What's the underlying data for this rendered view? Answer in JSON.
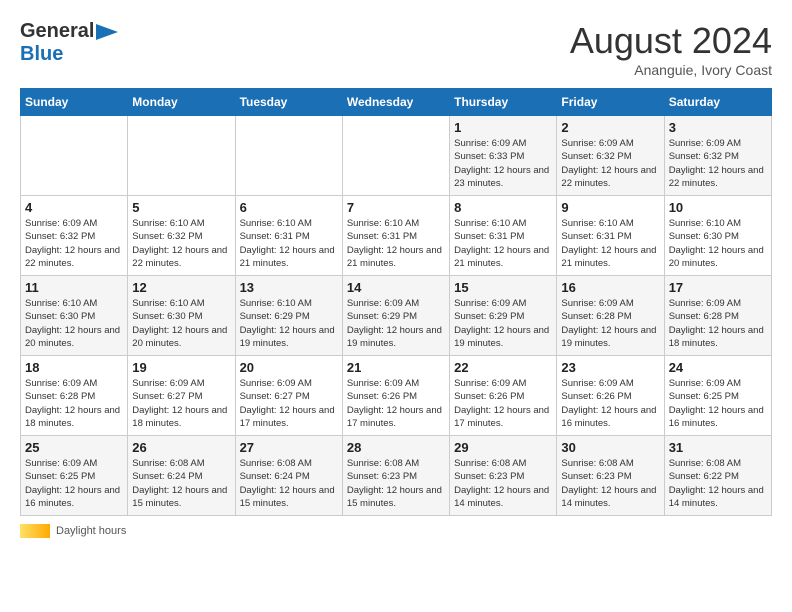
{
  "header": {
    "logo_general": "General",
    "logo_blue": "Blue",
    "month": "August 2024",
    "location": "Ananguie, Ivory Coast"
  },
  "days_of_week": [
    "Sunday",
    "Monday",
    "Tuesday",
    "Wednesday",
    "Thursday",
    "Friday",
    "Saturday"
  ],
  "weeks": [
    [
      {
        "day": "",
        "info": ""
      },
      {
        "day": "",
        "info": ""
      },
      {
        "day": "",
        "info": ""
      },
      {
        "day": "",
        "info": ""
      },
      {
        "day": "1",
        "info": "Sunrise: 6:09 AM\nSunset: 6:33 PM\nDaylight: 12 hours and 23 minutes."
      },
      {
        "day": "2",
        "info": "Sunrise: 6:09 AM\nSunset: 6:32 PM\nDaylight: 12 hours and 22 minutes."
      },
      {
        "day": "3",
        "info": "Sunrise: 6:09 AM\nSunset: 6:32 PM\nDaylight: 12 hours and 22 minutes."
      }
    ],
    [
      {
        "day": "4",
        "info": "Sunrise: 6:09 AM\nSunset: 6:32 PM\nDaylight: 12 hours and 22 minutes."
      },
      {
        "day": "5",
        "info": "Sunrise: 6:10 AM\nSunset: 6:32 PM\nDaylight: 12 hours and 22 minutes."
      },
      {
        "day": "6",
        "info": "Sunrise: 6:10 AM\nSunset: 6:31 PM\nDaylight: 12 hours and 21 minutes."
      },
      {
        "day": "7",
        "info": "Sunrise: 6:10 AM\nSunset: 6:31 PM\nDaylight: 12 hours and 21 minutes."
      },
      {
        "day": "8",
        "info": "Sunrise: 6:10 AM\nSunset: 6:31 PM\nDaylight: 12 hours and 21 minutes."
      },
      {
        "day": "9",
        "info": "Sunrise: 6:10 AM\nSunset: 6:31 PM\nDaylight: 12 hours and 21 minutes."
      },
      {
        "day": "10",
        "info": "Sunrise: 6:10 AM\nSunset: 6:30 PM\nDaylight: 12 hours and 20 minutes."
      }
    ],
    [
      {
        "day": "11",
        "info": "Sunrise: 6:10 AM\nSunset: 6:30 PM\nDaylight: 12 hours and 20 minutes."
      },
      {
        "day": "12",
        "info": "Sunrise: 6:10 AM\nSunset: 6:30 PM\nDaylight: 12 hours and 20 minutes."
      },
      {
        "day": "13",
        "info": "Sunrise: 6:10 AM\nSunset: 6:29 PM\nDaylight: 12 hours and 19 minutes."
      },
      {
        "day": "14",
        "info": "Sunrise: 6:09 AM\nSunset: 6:29 PM\nDaylight: 12 hours and 19 minutes."
      },
      {
        "day": "15",
        "info": "Sunrise: 6:09 AM\nSunset: 6:29 PM\nDaylight: 12 hours and 19 minutes."
      },
      {
        "day": "16",
        "info": "Sunrise: 6:09 AM\nSunset: 6:28 PM\nDaylight: 12 hours and 19 minutes."
      },
      {
        "day": "17",
        "info": "Sunrise: 6:09 AM\nSunset: 6:28 PM\nDaylight: 12 hours and 18 minutes."
      }
    ],
    [
      {
        "day": "18",
        "info": "Sunrise: 6:09 AM\nSunset: 6:28 PM\nDaylight: 12 hours and 18 minutes."
      },
      {
        "day": "19",
        "info": "Sunrise: 6:09 AM\nSunset: 6:27 PM\nDaylight: 12 hours and 18 minutes."
      },
      {
        "day": "20",
        "info": "Sunrise: 6:09 AM\nSunset: 6:27 PM\nDaylight: 12 hours and 17 minutes."
      },
      {
        "day": "21",
        "info": "Sunrise: 6:09 AM\nSunset: 6:26 PM\nDaylight: 12 hours and 17 minutes."
      },
      {
        "day": "22",
        "info": "Sunrise: 6:09 AM\nSunset: 6:26 PM\nDaylight: 12 hours and 17 minutes."
      },
      {
        "day": "23",
        "info": "Sunrise: 6:09 AM\nSunset: 6:26 PM\nDaylight: 12 hours and 16 minutes."
      },
      {
        "day": "24",
        "info": "Sunrise: 6:09 AM\nSunset: 6:25 PM\nDaylight: 12 hours and 16 minutes."
      }
    ],
    [
      {
        "day": "25",
        "info": "Sunrise: 6:09 AM\nSunset: 6:25 PM\nDaylight: 12 hours and 16 minutes."
      },
      {
        "day": "26",
        "info": "Sunrise: 6:08 AM\nSunset: 6:24 PM\nDaylight: 12 hours and 15 minutes."
      },
      {
        "day": "27",
        "info": "Sunrise: 6:08 AM\nSunset: 6:24 PM\nDaylight: 12 hours and 15 minutes."
      },
      {
        "day": "28",
        "info": "Sunrise: 6:08 AM\nSunset: 6:23 PM\nDaylight: 12 hours and 15 minutes."
      },
      {
        "day": "29",
        "info": "Sunrise: 6:08 AM\nSunset: 6:23 PM\nDaylight: 12 hours and 14 minutes."
      },
      {
        "day": "30",
        "info": "Sunrise: 6:08 AM\nSunset: 6:23 PM\nDaylight: 12 hours and 14 minutes."
      },
      {
        "day": "31",
        "info": "Sunrise: 6:08 AM\nSunset: 6:22 PM\nDaylight: 12 hours and 14 minutes."
      }
    ]
  ],
  "legend": {
    "daylight_label": "Daylight hours"
  }
}
